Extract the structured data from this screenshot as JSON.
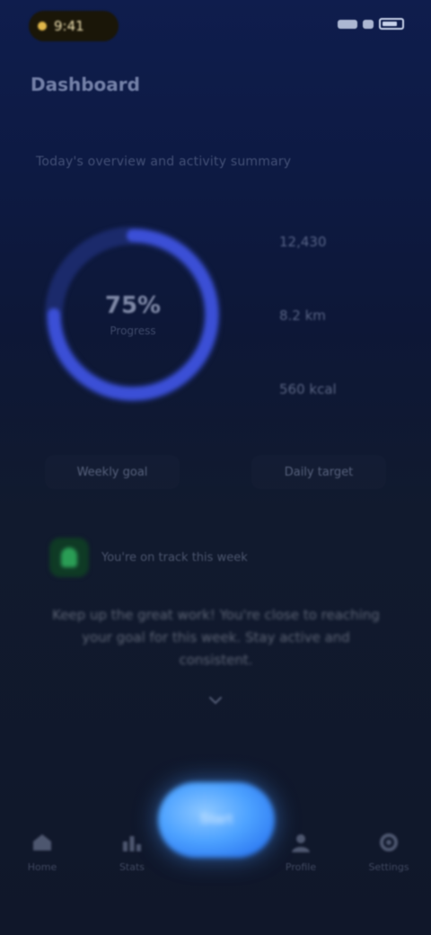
{
  "status_bar": {
    "time": "9:41",
    "icons": [
      "signal-icon",
      "wifi-icon",
      "battery-icon"
    ]
  },
  "header": {
    "title": "Dashboard"
  },
  "overview": {
    "subtitle": "Today's overview and activity summary",
    "ring": {
      "value": "75%",
      "caption": "Progress",
      "progress": 0.75,
      "track_color": "#1b2a6b",
      "fill_color": "#3b4fd6"
    },
    "stats": [
      {
        "text": "12,430"
      },
      {
        "text": "8.2 km"
      },
      {
        "text": "560 kcal"
      }
    ],
    "chips": [
      {
        "text": "Weekly goal"
      },
      {
        "text": "Daily target"
      }
    ]
  },
  "alert": {
    "text": "You're on track this week"
  },
  "message": {
    "text": "Keep up the great work! You're close to reaching your goal for this week. Stay active and consistent."
  },
  "tab_bar": {
    "tabs": [
      {
        "label": "Home",
        "icon": "home-icon"
      },
      {
        "label": "Stats",
        "icon": "chart-icon"
      },
      {
        "label": "Profile",
        "icon": "profile-icon"
      },
      {
        "label": "Settings",
        "icon": "settings-icon"
      }
    ],
    "center_button": {
      "label": "Start",
      "color": "#4da2ff"
    }
  }
}
